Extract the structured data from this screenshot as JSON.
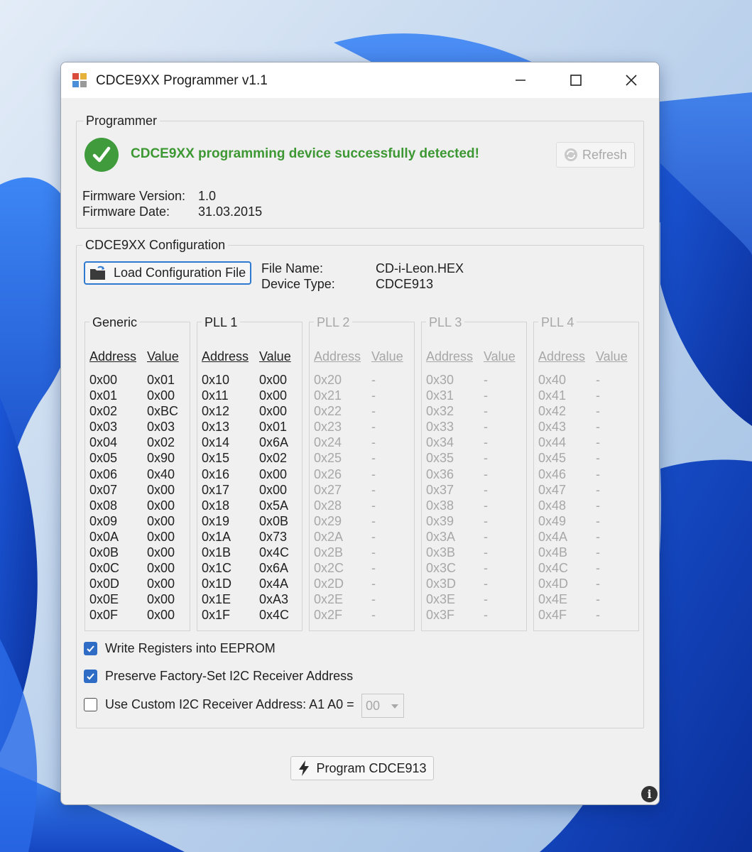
{
  "window": {
    "title": "CDCE9XX Programmer v1.1"
  },
  "programmer": {
    "group_label": "Programmer",
    "status": "CDCE9XX programming device successfully detected!",
    "refresh_label": "Refresh",
    "firmware_version_label": "Firmware Version:",
    "firmware_version": "1.0",
    "firmware_date_label": "Firmware Date:",
    "firmware_date": "31.03.2015"
  },
  "config": {
    "group_label": "CDCE9XX Configuration",
    "load_label": "Load Configuration File",
    "file_name_label": "File Name:",
    "file_name": "CD-i-Leon.HEX",
    "device_type_label": "Device Type:",
    "device_type": "CDCE913"
  },
  "register_headers": {
    "address": "Address",
    "value": "Value"
  },
  "registers": [
    {
      "label": "Generic",
      "enabled": true,
      "addresses": "0x00\n0x01\n0x02\n0x03\n0x04\n0x05\n0x06\n0x07\n0x08\n0x09\n0x0A\n0x0B\n0x0C\n0x0D\n0x0E\n0x0F",
      "values": "0x01\n0x00\n0xBC\n0x03\n0x02\n0x90\n0x40\n0x00\n0x00\n0x00\n0x00\n0x00\n0x00\n0x00\n0x00\n0x00"
    },
    {
      "label": "PLL 1",
      "enabled": true,
      "addresses": "0x10\n0x11\n0x12\n0x13\n0x14\n0x15\n0x16\n0x17\n0x18\n0x19\n0x1A\n0x1B\n0x1C\n0x1D\n0x1E\n0x1F",
      "values": "0x00\n0x00\n0x00\n0x01\n0x6A\n0x02\n0x00\n0x00\n0x5A\n0x0B\n0x73\n0x4C\n0x6A\n0x4A\n0xA3\n0x4C"
    },
    {
      "label": "PLL 2",
      "enabled": false,
      "addresses": "0x20\n0x21\n0x22\n0x23\n0x24\n0x25\n0x26\n0x27\n0x28\n0x29\n0x2A\n0x2B\n0x2C\n0x2D\n0x2E\n0x2F",
      "values": "-\n-\n-\n-\n-\n-\n-\n-\n-\n-\n-\n-\n-\n-\n-\n-"
    },
    {
      "label": "PLL 3",
      "enabled": false,
      "addresses": "0x30\n0x31\n0x32\n0x33\n0x34\n0x35\n0x36\n0x37\n0x38\n0x39\n0x3A\n0x3B\n0x3C\n0x3D\n0x3E\n0x3F",
      "values": "-\n-\n-\n-\n-\n-\n-\n-\n-\n-\n-\n-\n-\n-\n-\n-"
    },
    {
      "label": "PLL 4",
      "enabled": false,
      "addresses": "0x40\n0x41\n0x42\n0x43\n0x44\n0x45\n0x46\n0x47\n0x48\n0x49\n0x4A\n0x4B\n0x4C\n0x4D\n0x4E\n0x4F",
      "values": "-\n-\n-\n-\n-\n-\n-\n-\n-\n-\n-\n-\n-\n-\n-\n-"
    }
  ],
  "options": {
    "write_eeprom": {
      "label": "Write Registers into EEPROM",
      "checked": true
    },
    "preserve_address": {
      "label": "Preserve Factory-Set I2C Receiver Address",
      "checked": true
    },
    "custom_address": {
      "label": "Use Custom I2C Receiver Address: A1 A0 =",
      "checked": false,
      "selected": "00"
    }
  },
  "program_label": "Program CDCE913",
  "colors": {
    "accent": "#2f6cc6",
    "success": "#3d9834",
    "disabled_text": "#a7a7a7"
  },
  "icons": [
    "app-icon",
    "minimize-icon",
    "maximize-icon",
    "close-icon",
    "success-check-icon",
    "refresh-icon",
    "folder-load-icon",
    "checkbox-check-icon",
    "dropdown-arrow-icon",
    "lightning-icon",
    "info-icon"
  ]
}
